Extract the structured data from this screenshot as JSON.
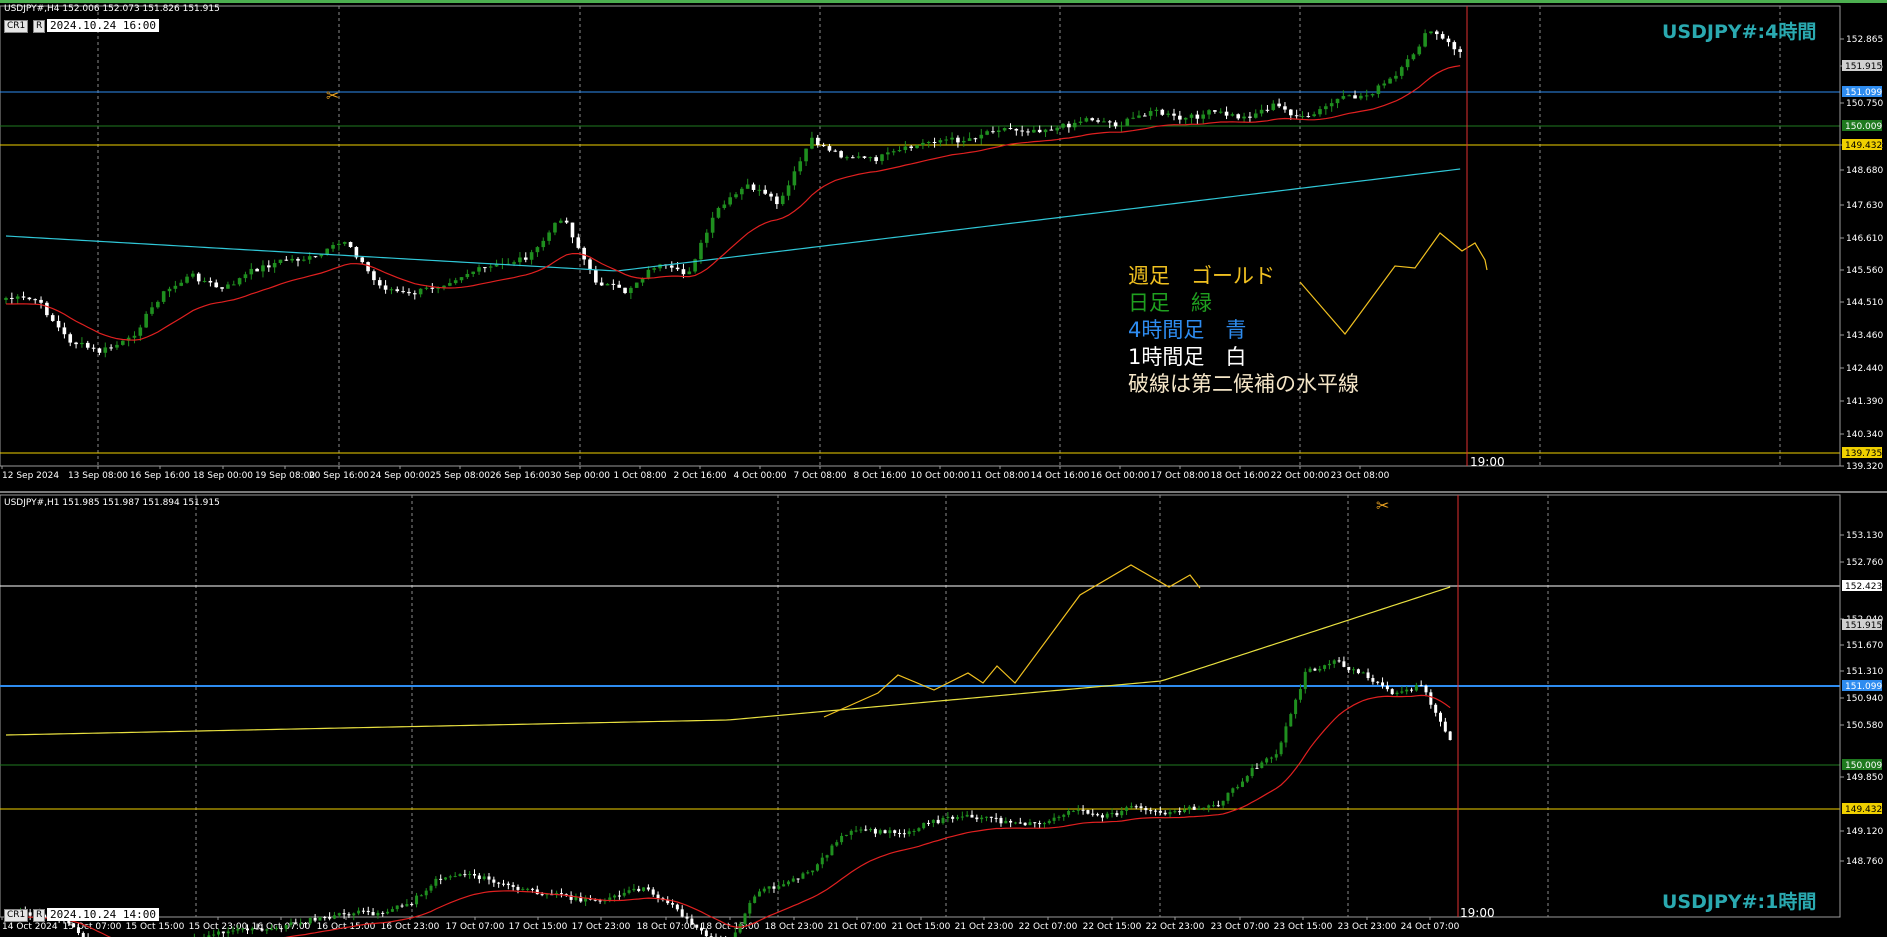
{
  "top_chart": {
    "symbol_line": "USDJPY#,H4  152.006 152.073 151.826 151.915",
    "btn_cr": "CR1",
    "btn_r": "R",
    "date_box": "2024.10.24 16:00",
    "title": "USDJPY#:4時間",
    "vline_label": "19:00",
    "legend": [
      {
        "text": "週足　ゴールド",
        "color": "#f0c020"
      },
      {
        "text": "日足　緑",
        "color": "#1fa01f"
      },
      {
        "text": "4時間足　青",
        "color": "#2e8cf0"
      },
      {
        "text": "1時間足　白",
        "color": "#ffffff"
      },
      {
        "text": "破線は第二候補の水平線",
        "color": "#f5e6c8"
      }
    ],
    "price_labels": [
      "152.865",
      "151.915",
      "150.750",
      "149.432",
      "148.680",
      "147.630",
      "146.610",
      "145.560",
      "144.510",
      "143.460",
      "142.440",
      "141.390",
      "140.340",
      "139.320"
    ],
    "level_labels": [
      {
        "text": "151.099",
        "color": "#2e8cf0"
      },
      {
        "text": "150.009",
        "color": "#1f7a1f"
      },
      {
        "text": "149.432",
        "color": "#f0d000"
      },
      {
        "text": "139.735",
        "color": "#f0d000"
      },
      {
        "text": "151.915",
        "color": "#d0d0d0"
      }
    ],
    "time_labels": [
      "12 Sep 2024",
      "13 Sep 08:00",
      "16 Sep 16:00",
      "18 Sep 00:00",
      "19 Sep 08:00",
      "20 Sep 16:00",
      "24 Sep 00:00",
      "25 Sep 08:00",
      "26 Sep 16:00",
      "30 Sep 00:00",
      "1 Oct 08:00",
      "2 Oct 16:00",
      "4 Oct 00:00",
      "7 Oct 08:00",
      "8 Oct 16:00",
      "10 Oct 00:00",
      "11 Oct 08:00",
      "14 Oct 16:00",
      "16 Oct 00:00",
      "17 Oct 08:00",
      "18 Oct 16:00",
      "22 Oct 00:00",
      "23 Oct 08:00"
    ]
  },
  "bottom_chart": {
    "symbol_line": "USDJPY#,H1  151.985 151.987 151.894 151.915",
    "btn_cr": "CR1",
    "btn_r": "R",
    "date_box": "2024.10.24 14:00",
    "title": "USDJPY#:1時間",
    "vline_label": "19:00",
    "price_labels": [
      "153.130",
      "152.760",
      "152.040",
      "151.670",
      "151.310",
      "150.940",
      "150.580",
      "149.850",
      "149.120",
      "148.760"
    ],
    "level_labels": [
      {
        "text": "152.423",
        "color": "#ffffff"
      },
      {
        "text": "151.915",
        "color": "#d0d0d0"
      },
      {
        "text": "151.099",
        "color": "#2e8cf0"
      },
      {
        "text": "150.009",
        "color": "#1f7a1f"
      },
      {
        "text": "149.432",
        "color": "#f0d000"
      }
    ],
    "time_labels": [
      "14 Oct 2024",
      "15 Oct 07:00",
      "15 Oct 15:00",
      "15 Oct 23:00",
      "16 Oct 07:00",
      "16 Oct 15:00",
      "16 Oct 23:00",
      "17 Oct 07:00",
      "17 Oct 15:00",
      "17 Oct 23:00",
      "18 Oct 07:00",
      "18 Oct 15:00",
      "18 Oct 23:00",
      "21 Oct 07:00",
      "21 Oct 15:00",
      "21 Oct 23:00",
      "22 Oct 07:00",
      "22 Oct 15:00",
      "22 Oct 23:00",
      "23 Oct 07:00",
      "23 Oct 15:00",
      "23 Oct 23:00",
      "24 Oct 07:00"
    ]
  },
  "colors": {
    "bull": "#1f8f1f",
    "bear": "#ffffff",
    "grid": "#8a8a8a",
    "ma_fast": "#e02020",
    "ma_slow_top": "#30c8d8",
    "ma_slow_bottom": "#e8e040",
    "zigzag": "#f0c020",
    "vline": "#e03030"
  }
}
